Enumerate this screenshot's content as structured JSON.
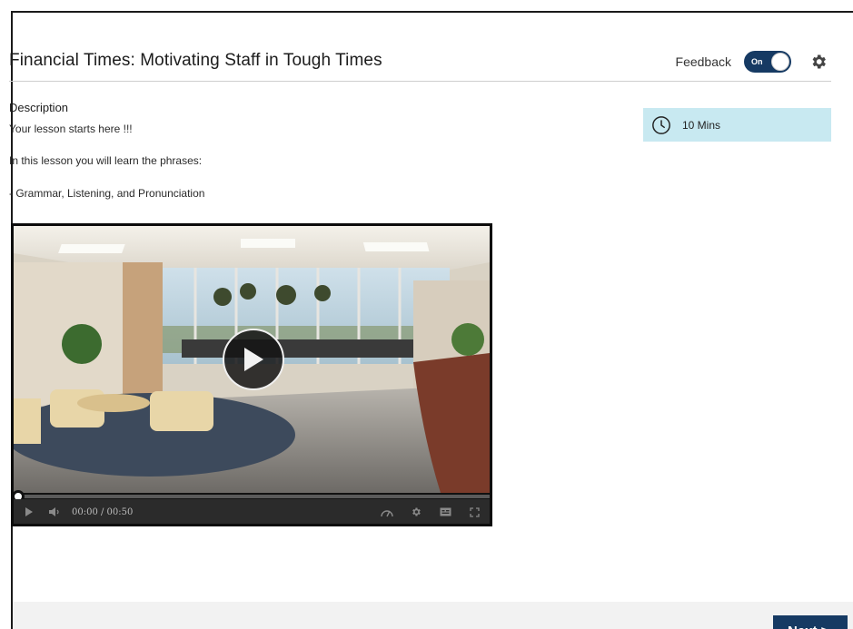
{
  "header": {
    "title": "Financial Times: Motivating Staff in Tough Times",
    "feedback_label": "Feedback",
    "toggle_label": "On",
    "settings_icon": "gear-icon"
  },
  "description": {
    "heading": "Description",
    "lines": [
      "Your lesson starts here !!!",
      "In this lesson you will learn the phrases:",
      "- Grammar, Listening, and Pronunciation"
    ]
  },
  "duration": {
    "icon": "clock-icon",
    "text": "10 Mins"
  },
  "video": {
    "time_display": "00:00 / 00:50",
    "progress": 0
  },
  "footer": {
    "next_label": "Next >"
  },
  "colors": {
    "accent_navy": "#163a63",
    "duration_bg": "#c8e9f1",
    "footer_bg": "#f2f2f2"
  }
}
